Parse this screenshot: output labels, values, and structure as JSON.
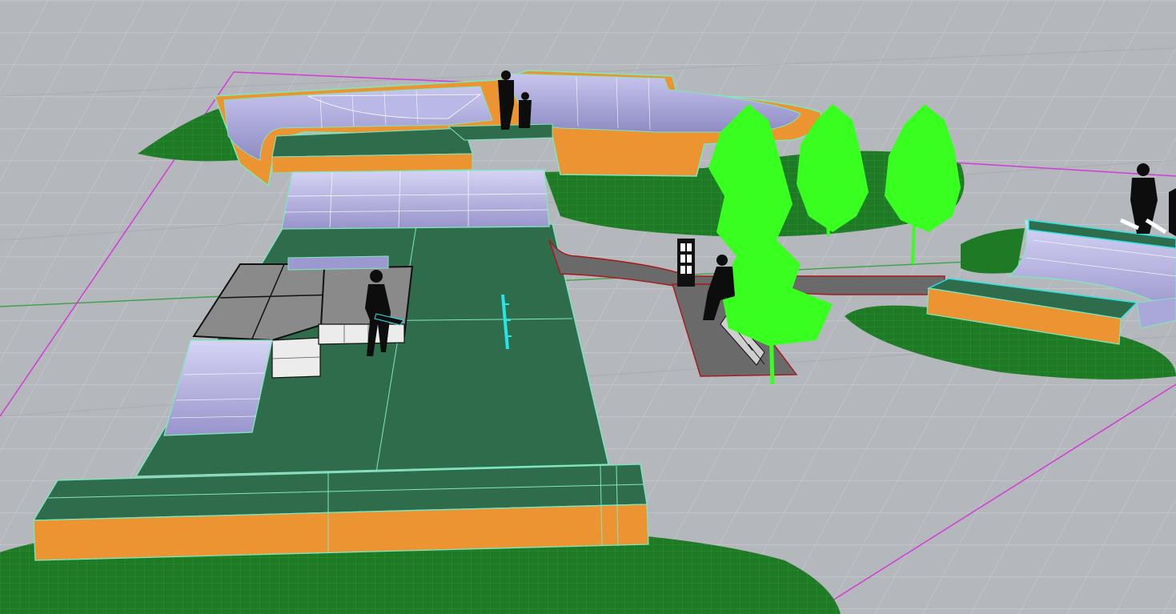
{
  "viewport": {
    "view": "perspective",
    "display_mode": "rendered",
    "object_types": [
      "ground-grid",
      "construction-plane-axes",
      "selection-boundary",
      "skatepark-bowl",
      "quarter-pipe-ramp",
      "funbox",
      "launch-ramp",
      "ledge",
      "flat-bank",
      "concrete-deck",
      "grass-mound",
      "tree",
      "path",
      "bench-area",
      "phone-booth",
      "person-silhouette",
      "mini-ramp"
    ]
  },
  "colors": {
    "background": "#b4b8bc",
    "grid_line": "#ced2d5",
    "grid_major": "#a09aa0",
    "x_axis": "#3fa04a",
    "boundary": "#d43ad8",
    "deck": "#2f6c4c",
    "ramp_face": "#aaa8d8",
    "ramp_side": "#ec9432",
    "grass": "#1f7a26",
    "tree": "#39ff20",
    "concrete": "#6a6a6a",
    "box_top": "#8a8a8a",
    "box_side": "#ececec",
    "highlight_edge": "#7de8c0",
    "selection_cyan": "#28e4e6",
    "path_edge": "#a81818",
    "silhouette": "#0d0d0d"
  }
}
